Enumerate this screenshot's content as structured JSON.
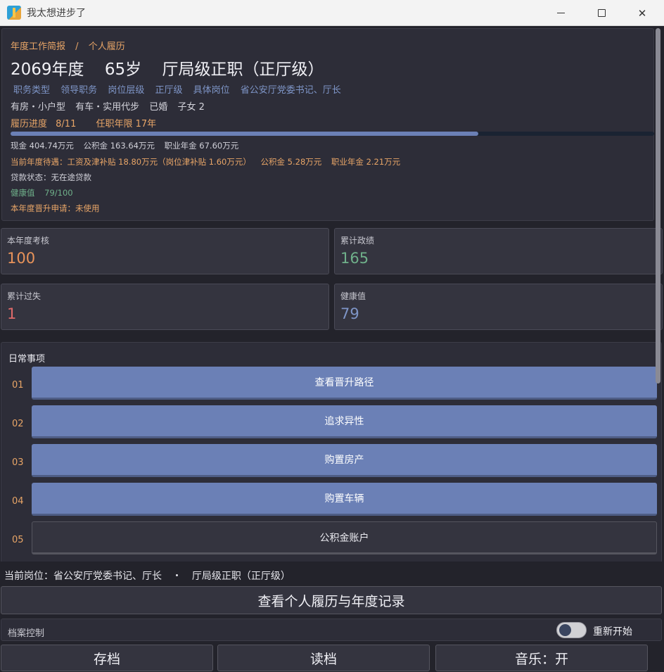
{
  "window": {
    "title": "我太想进步了"
  },
  "profile": {
    "breadcrumb": [
      "年度工作简报",
      "/",
      "个人履历"
    ],
    "year": "2069年度",
    "age": "65岁",
    "rank": "厅局级正职（正厅级）",
    "tags": [
      "职务类型",
      "领导职务",
      "岗位层级",
      "正厅级",
      "具体岗位",
      "省公安厅党委书记、厅长"
    ],
    "assets": [
      "有房・小户型",
      "有车・实用代步",
      "已婚",
      "子女 2"
    ],
    "progress_label": "履历进度",
    "progress_value": "8/11",
    "tenure": "任职年限 17年",
    "progress_fraction": 0.7273,
    "money": [
      "现金 404.74万元",
      "公积金 163.64万元",
      "职业年金 67.60万元"
    ],
    "benefits": [
      "当前年度待遇：工资及津补贴 18.80万元（岗位津补贴 1.60万元）",
      "公积金 5.28万元",
      "职业年金 2.21万元"
    ],
    "loan": "贷款状态：无在途贷款",
    "health_label": "健康值",
    "health_value": "79/100",
    "promotion": "本年度晋升申请：未使用"
  },
  "stats": {
    "assessment": {
      "label": "本年度考核",
      "value": "100",
      "color": "#e8935a"
    },
    "achievements": {
      "label": "累计政绩",
      "value": "165",
      "color": "#6fb08a"
    },
    "faults": {
      "label": "累计过失",
      "value": "1",
      "color": "#e06a6a"
    },
    "health": {
      "label": "健康值",
      "value": "79",
      "color": "#7e95c7"
    }
  },
  "daily": {
    "title": "日常事项",
    "items": [
      {
        "num": "01",
        "label": "查看晋升路径"
      },
      {
        "num": "02",
        "label": "追求异性"
      },
      {
        "num": "03",
        "label": "购置房产"
      },
      {
        "num": "04",
        "label": "购置车辆"
      },
      {
        "num": "05",
        "label": "公积金账户"
      }
    ]
  },
  "bottom": {
    "current_post": "当前岗位：省公安厅党委书记、厅长",
    "separator": "・",
    "current_rank": "厅局级正职（正厅级）",
    "history_button": "查看个人履历与年度记录",
    "archive_label": "档案控制",
    "restart_label": "重新开始",
    "save_button": "存档",
    "load_button": "读档",
    "music_button": "音乐：开"
  },
  "colors": {
    "accent_orange": "#e8a567",
    "accent_blue": "#6b80b6",
    "panel": "#2d2d38",
    "background": "#23232b"
  }
}
